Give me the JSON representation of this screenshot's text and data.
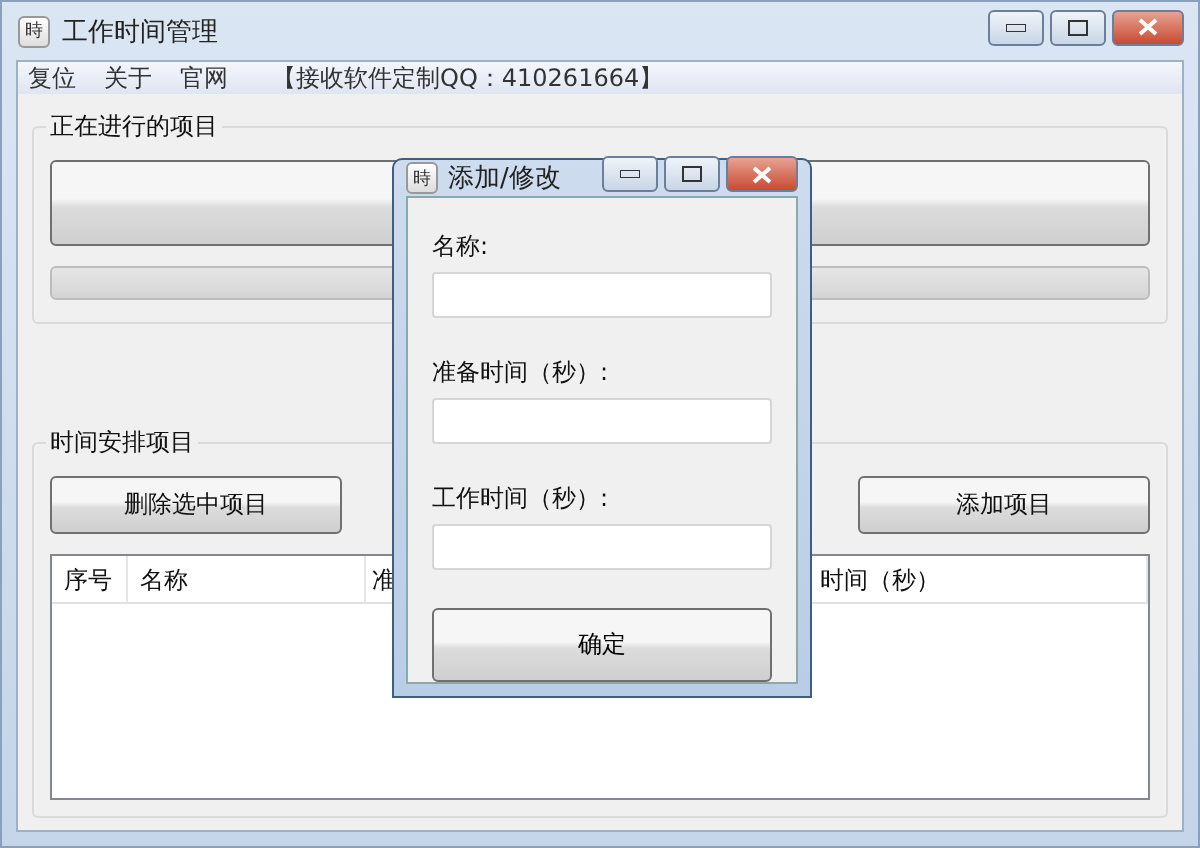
{
  "window": {
    "title": "工作时间管理",
    "icon": "時"
  },
  "menu": [
    "复位",
    "关于",
    "官网"
  ],
  "menu_note": "【接收软件定制QQ：410261664】",
  "current_group": {
    "title": "正在进行的项目",
    "progress": {
      "level": 0
    }
  },
  "schedule_group": {
    "title": "时间安排项目",
    "buttons": [
      "删除选中项目",
      "添加项目"
    ],
    "columns": [
      "序号",
      "名称",
      "准",
      "时间（秒）"
    ]
  },
  "dialog": {
    "title": "添加/修改",
    "icon": "時",
    "fields": [
      {
        "label": "名称:"
      },
      {
        "label": "准备时间（秒）:"
      },
      {
        "label": "工作时间（秒）:"
      }
    ],
    "button": "确定"
  }
}
